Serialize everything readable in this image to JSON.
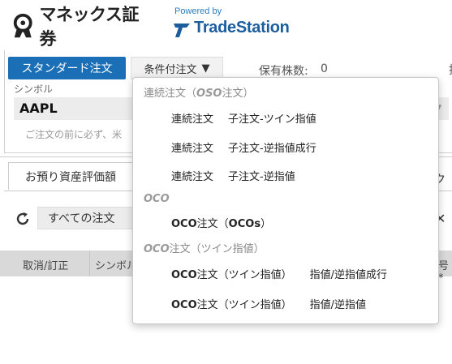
{
  "header": {
    "monex_brand": "マネックス証券",
    "ts_powered_by": "Powered by",
    "ts_name": "TradeStation",
    "brand_color": "#1b5e9e"
  },
  "order": {
    "standard_tab": "スタンダード注文",
    "conditional_tab": "条件付注文",
    "conditional_caret": "▼",
    "holdings_label": "保有株数:",
    "holdings_value": "0",
    "edge_char": "抹",
    "symbol_label": "シンボル",
    "symbol_value": "AAPL",
    "notice": "ご注文の前に必ず、米"
  },
  "tabs": {
    "assets": "お預り資産評価額",
    "right": "ク"
  },
  "orders_list": {
    "filter_value": "すべての注文",
    "columns": [
      "取消/訂正",
      "シンボル"
    ],
    "right_col": "号*"
  },
  "dropdown": {
    "groups": [
      {
        "header_italic": "OSO",
        "header_prefix": "連続注文（",
        "header_suffix": "注文）",
        "items": [
          {
            "a": "連続注文",
            "b": "子注文-ツイン指値"
          },
          {
            "a": "連続注文",
            "b": "子注文-逆指値成行"
          },
          {
            "a": "連続注文",
            "b": "子注文-逆指値"
          }
        ]
      },
      {
        "header_italic": "OCO",
        "header_prefix": "",
        "header_suffix": "",
        "items": [
          {
            "bold": "OCO",
            "a": "注文（",
            "bold2": "OCOs",
            "b": "）"
          }
        ]
      },
      {
        "header_italic": "OCO",
        "header_prefix": "",
        "header_suffix": "注文（ツイン指値）",
        "items": [
          {
            "bold": "OCO",
            "a": "注文（ツイン指値）",
            "b": "指値/逆指値成行"
          },
          {
            "bold": "OCO",
            "a": "注文（ツイン指値）",
            "b": "指値/逆指値"
          }
        ]
      }
    ]
  }
}
